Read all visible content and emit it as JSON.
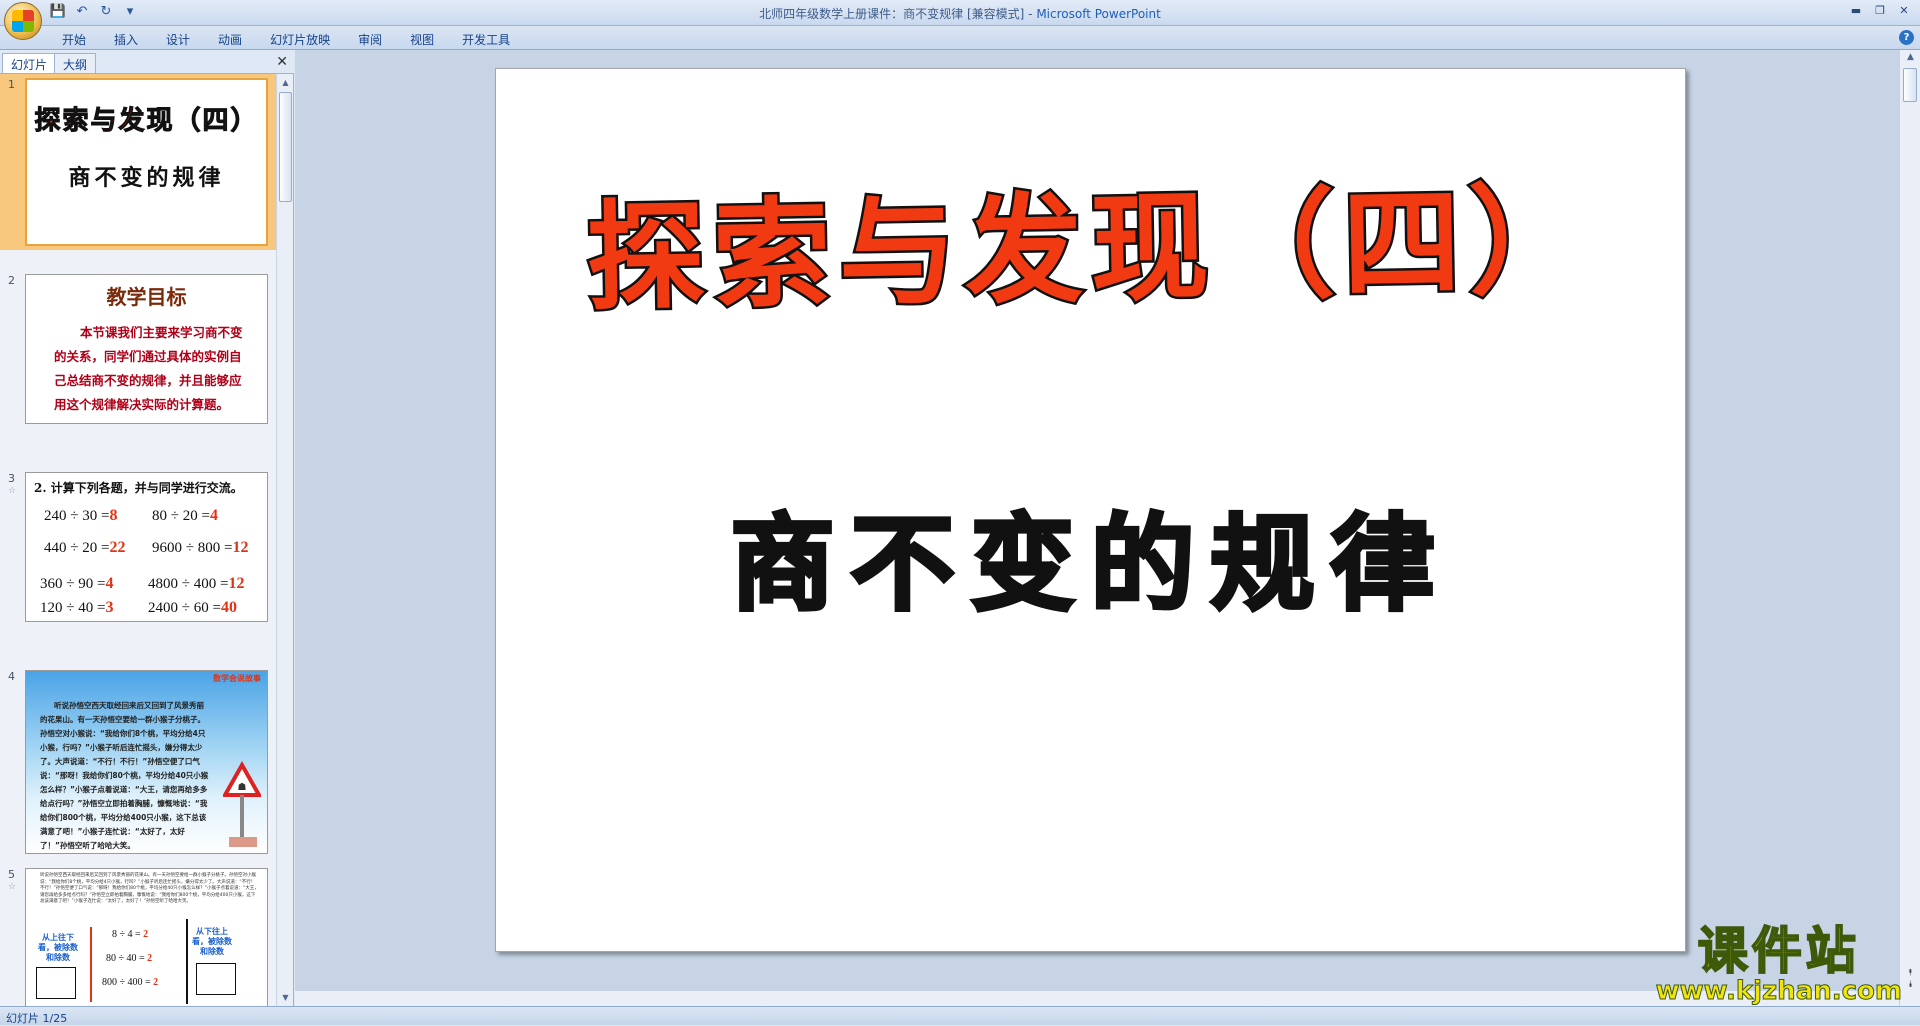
{
  "window": {
    "title_doc": "北师四年级数学上册课件：商不变规律 [兼容模式]",
    "title_sep": " - ",
    "title_app": "Microsoft PowerPoint"
  },
  "ribbon": {
    "tabs": [
      "开始",
      "插入",
      "设计",
      "动画",
      "幻灯片放映",
      "审阅",
      "视图",
      "开发工具"
    ]
  },
  "panel": {
    "tab_slides": "幻灯片",
    "tab_outline": "大纲"
  },
  "slides": [
    {
      "num": "1",
      "title": "探索与发现（四）",
      "subtitle": "商不变的规律"
    },
    {
      "num": "2",
      "title": "教学目标",
      "body": "本节课我们主要来学习商不变的关系，同学们通过具体的实例自己总结商不变的规律，并且能够应用这个规律解决实际的计算题。"
    },
    {
      "num": "3",
      "heading": "2. 计算下列各题，并与同学进行交流。",
      "rows": [
        {
          "a": "240 ÷ 30 =",
          "a_ans": "8",
          "b": "80 ÷ 20 =",
          "b_ans": "4"
        },
        {
          "a": "440 ÷ 20 =",
          "a_ans": "22",
          "b": "9600 ÷ 800 =",
          "b_ans": "12"
        },
        {
          "a": "360 ÷ 90 =",
          "a_ans": "4",
          "b": "4800 ÷ 400 =",
          "b_ans": "12"
        },
        {
          "a": "120 ÷ 40 =",
          "a_ans": "3",
          "b": "2400 ÷ 60 =",
          "b_ans": "40"
        }
      ]
    },
    {
      "num": "4",
      "tag": "数学会说故事",
      "text": "听说孙悟空西天取经回来后又回到了风景秀丽的花果山。有一天孙悟空要给一群小猴子分桃子。孙悟空对小猴说：“我给你们8个桃，平均分给4只小猴，行吗？”小猴子听后连忙摇头，嫌分得太少了。大声说道：“不行！不行！”孙悟空便了口气说：“那呀！我给你们80个桃，平均分给40只小猴怎么样？”小猴子点着说道：“大王，请您再给多多给点行吗？”孙悟空立即拍着胸脯，慷慨地说：“我给你们800个桃，平均分给400只小猴，这下总该满意了吧！”小猴子连忙说：“太好了，太好了！”孙悟空听了哈哈大笑。"
    },
    {
      "num": "5",
      "left_label": "从上往下看，被除数和除数",
      "right_label": "从下往上看，被除数和除数",
      "eqs": [
        {
          "q": "8 ÷ 4 =",
          "ans": "2"
        },
        {
          "q": "80 ÷ 40 =",
          "ans": "2"
        },
        {
          "q": "800 ÷ 400 =",
          "ans": "2"
        }
      ]
    }
  ],
  "main_slide": {
    "title": "探索与发现（四）",
    "subtitle": "商不变的规律"
  },
  "status": {
    "slide_indicator": "幻灯片 1/25"
  },
  "watermark": {
    "name": "课件站",
    "url": "www.kjzhan.com"
  }
}
